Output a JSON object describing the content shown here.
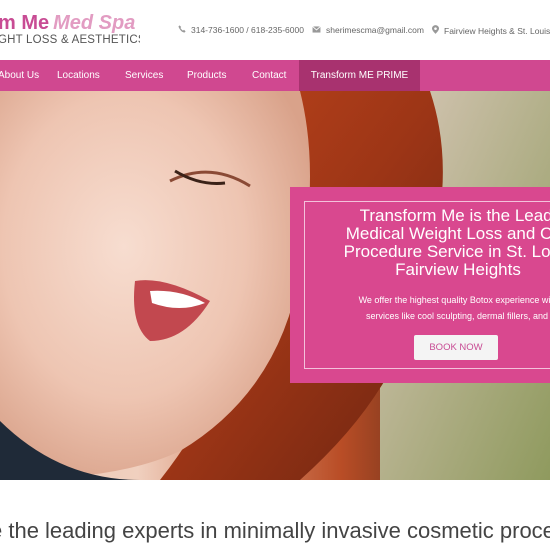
{
  "header": {
    "logo_line1_main": "m Me",
    "logo_line1_italic": "Med Spa",
    "logo_line2": "GHT LOSS & AESTHETICS",
    "phone": "314-736-1600 / 618-235-6000",
    "email": "sherimescma@gmail.com",
    "location": "Fairview Heights & St. Louis"
  },
  "nav": {
    "items": [
      "About Us",
      "Locations",
      "Services",
      "Products",
      "Contact",
      "Transform ME PRIME"
    ]
  },
  "hero": {
    "title_lines": [
      "Transform Me is the Leadi",
      "Medical Weight Loss and Cos",
      "Procedure Service in St. Louis",
      "Fairview Heights"
    ],
    "text_lines": [
      "We offer the highest quality Botox experience with u",
      "services like cool sculpting, dermal fillers, and m"
    ],
    "book_now": "BOOK NOW"
  },
  "section": {
    "heading": "e the leading experts in minimally invasive cosmetic proce"
  },
  "colors": {
    "brand_pink": "#d04890",
    "nav_active": "#a8326f",
    "promo_bg": "#d9488f"
  }
}
